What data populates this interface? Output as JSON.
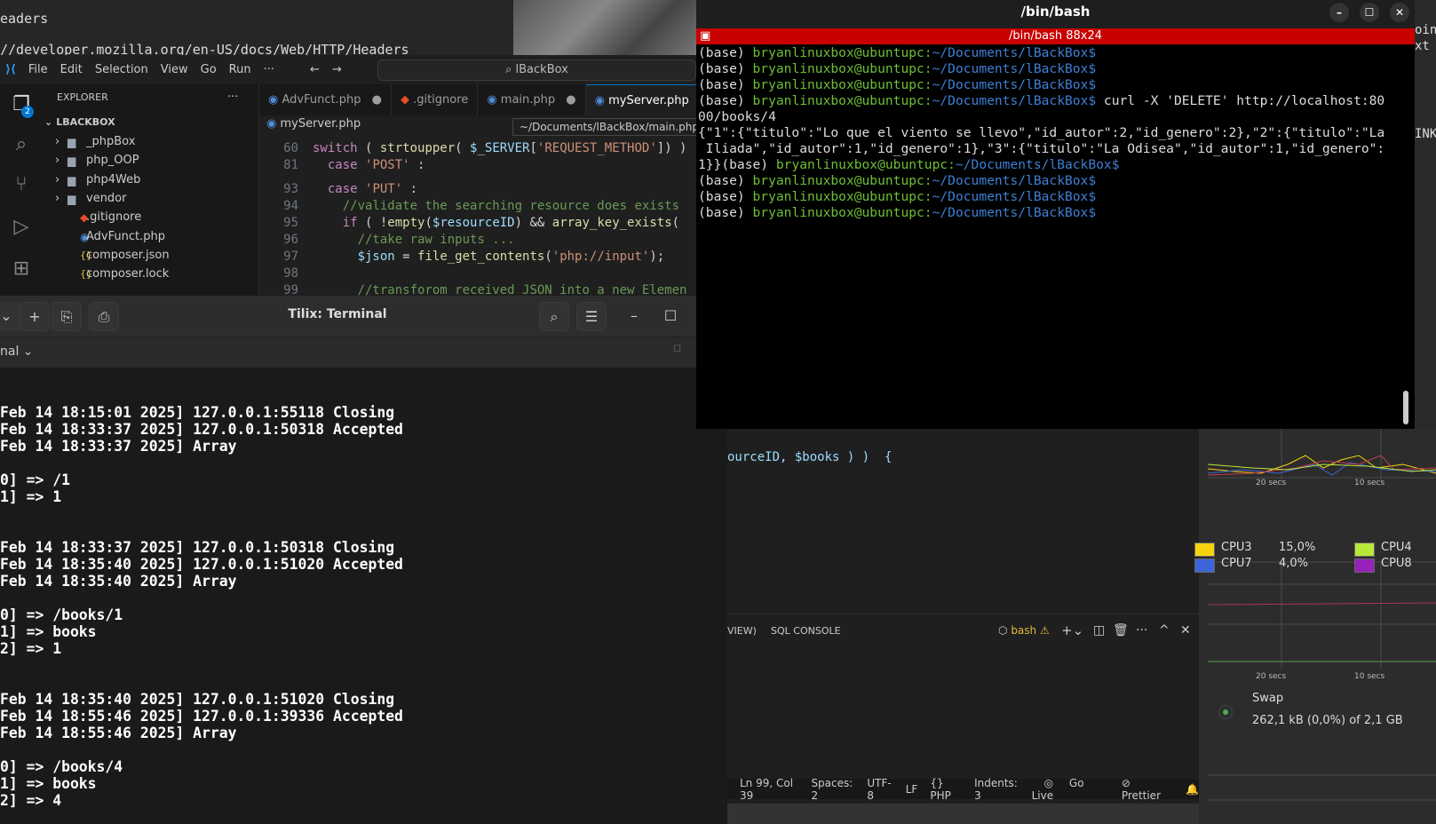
{
  "browser": {
    "heading": "eaders",
    "url": "//developer.mozilla.org/en-US/docs/Web/HTTP/Headers",
    "right_text_1": "oint_",
    "right_text_2": "xt",
    "right_text_3": "INK"
  },
  "vscode": {
    "menu": [
      "File",
      "Edit",
      "Selection",
      "View",
      "Go",
      "Run",
      "···"
    ],
    "command_center": "lBackBox",
    "explorer_title": "EXPLORER",
    "explorer_more": "···",
    "badge": "2",
    "root": "LBACKBOX",
    "tree": [
      {
        "name": "_phpBox",
        "type": "folder"
      },
      {
        "name": "php_OOP",
        "type": "folder"
      },
      {
        "name": "php4Web",
        "type": "folder"
      },
      {
        "name": "vendor",
        "type": "folder"
      },
      {
        "name": ".gitignore",
        "type": "git"
      },
      {
        "name": "AdvFunct.php",
        "type": "php"
      },
      {
        "name": "composer.json",
        "type": "json"
      },
      {
        "name": "composer.lock",
        "type": "json"
      }
    ],
    "tabs": [
      {
        "label": "AdvFunct.php",
        "dirty": true
      },
      {
        "label": ".gitignore",
        "dirty": false
      },
      {
        "label": "main.php",
        "dirty": true
      },
      {
        "label": "myServer.php",
        "dirty": false,
        "active": true
      }
    ],
    "breadcrumb": "myServer.php",
    "tooltip": "~/Documents/lBackBox/main.php",
    "code": [
      {
        "n": "60",
        "html": "<span class='kw'>switch</span> ( <span class='fn'>strtoupper</span>( <span class='var'>$_SERVER</span>[<span class='str'>'REQUEST_METHOD'</span>]) )"
      },
      {
        "n": "81",
        "html": "  <span class='kw'>case</span> <span class='str'>'POST'</span> :"
      },
      {
        "n": "93",
        "html": "  <span class='kw'>case</span> <span class='str'>'PUT'</span> :"
      },
      {
        "n": "94",
        "html": "    <span class='cm'>//validate the searching resource does exists</span>"
      },
      {
        "n": "95",
        "html": "    <span class='kw'>if</span> ( !<span class='fn'>empty</span>(<span class='var'>$resourceID</span>) &amp;&amp; <span class='fn'>array_key_exists</span>("
      },
      {
        "n": "96",
        "html": "      <span class='cm'>//take raw inputs ...</span>"
      },
      {
        "n": "97",
        "html": "      <span class='var'>$json</span> = <span class='fn'>file_get_contents</span>(<span class='str'>'php://input'</span>);"
      },
      {
        "n": "98",
        "html": ""
      },
      {
        "n": "99",
        "html": "      <span class='cm'>//transforom received JSON into a new Elemen</span>"
      }
    ],
    "code_cont": "ourceID, $books ) )  {",
    "panel_tabs": [
      "VIEW)",
      "SQL CONSOLE"
    ],
    "terminal_name": "bash",
    "status": [
      "Ln 99, Col 39",
      "Spaces: 2",
      "UTF-8",
      "LF",
      "{} PHP",
      "Indents: 3",
      "Go Live",
      "Prettier"
    ]
  },
  "tilix": {
    "title": "Tilix: Terminal",
    "session": "nal",
    "lines": [
      "Feb 14 18:15:01 2025] 127.0.0.1:55118 Closing",
      "Feb 14 18:33:37 2025] 127.0.0.1:50318 Accepted",
      "Feb 14 18:33:37 2025] Array",
      "",
      "0] => /1",
      "1] => 1",
      "",
      "",
      "Feb 14 18:33:37 2025] 127.0.0.1:50318 Closing",
      "Feb 14 18:35:40 2025] 127.0.0.1:51020 Accepted",
      "Feb 14 18:35:40 2025] Array",
      "",
      "0] => /books/1",
      "1] => books",
      "2] => 1",
      "",
      "",
      "Feb 14 18:35:40 2025] 127.0.0.1:51020 Closing",
      "Feb 14 18:55:46 2025] 127.0.0.1:39336 Accepted",
      "Feb 14 18:55:46 2025] Array",
      "",
      "0] => /books/4",
      "1] => books",
      "2] => 4"
    ]
  },
  "bash": {
    "title": "/bin/bash",
    "subtitle": "/bin/bash 88x24",
    "base": "(base) ",
    "user": "bryanlinuxbox@ubuntupc:",
    "path": "~/Documents/lBackBox$",
    "command": " curl -X 'DELETE' http://localhost:80",
    "output": [
      "00/books/4",
      "{\"1\":{\"titulo\":\"Lo que el viento se llevo\",\"id_autor\":2,\"id_genero\":2},\"2\":{\"titulo\":\"La",
      " Iliada\",\"id_autor\":1,\"id_genero\":1},\"3\":{\"titulo\":\"La Odisea\",\"id_autor\":1,\"id_genero\":"
    ],
    "output_tail": "1}}"
  },
  "monitor": {
    "ticks": [
      "20 secs",
      "10 secs"
    ],
    "cpus": [
      {
        "name": "CPU3",
        "value": "15,0%",
        "color": "#f5d40f"
      },
      {
        "name": "CPU7",
        "value": "4,0%",
        "color": "#3c66d8"
      },
      {
        "name": "CPU4",
        "value": "",
        "color": "#b9e83a"
      },
      {
        "name": "CPU8",
        "value": "",
        "color": "#9722b8"
      }
    ],
    "swap_label": "Swap",
    "swap_value": "262,1 kB (0,0%) of 2,1 GB"
  }
}
